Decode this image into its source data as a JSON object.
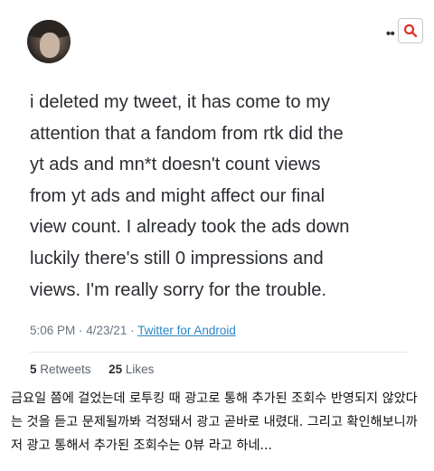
{
  "tweet": {
    "text": "i deleted my tweet,  it has come to my\nattention that a fandom from rtk did the\nyt ads and mn*t doesn't count views\nfrom yt ads and might affect our final\nview count. I already took the ads down\nluckily there's still 0 impressions and\nviews. I'm really sorry for the trouble.",
    "time": "5:06 PM",
    "date": "4/23/21",
    "separator": " · ",
    "source": "Twitter for Android",
    "retweets_count": "5",
    "retweets_label": "Retweets",
    "likes_count": "25",
    "likes_label": "Likes"
  },
  "caption": "금요일 쯤에 걸었는데 로투킹 때 광고로 통해 추가된 조회수 반영되지 않았다는 것을 듣고 문제될까봐 걱정돼서 광고 곧바로 내렸대. 그리고 확인해보니까 저 광고 통해서 추가된 조회수는 0뷰 라고 하네...",
  "colors": {
    "accent_red": "#e0322b",
    "link_blue": "#2b86c5"
  },
  "icons": {
    "menu": "more-dots-icon",
    "search": "search-icon",
    "avatar": "profile-avatar"
  }
}
